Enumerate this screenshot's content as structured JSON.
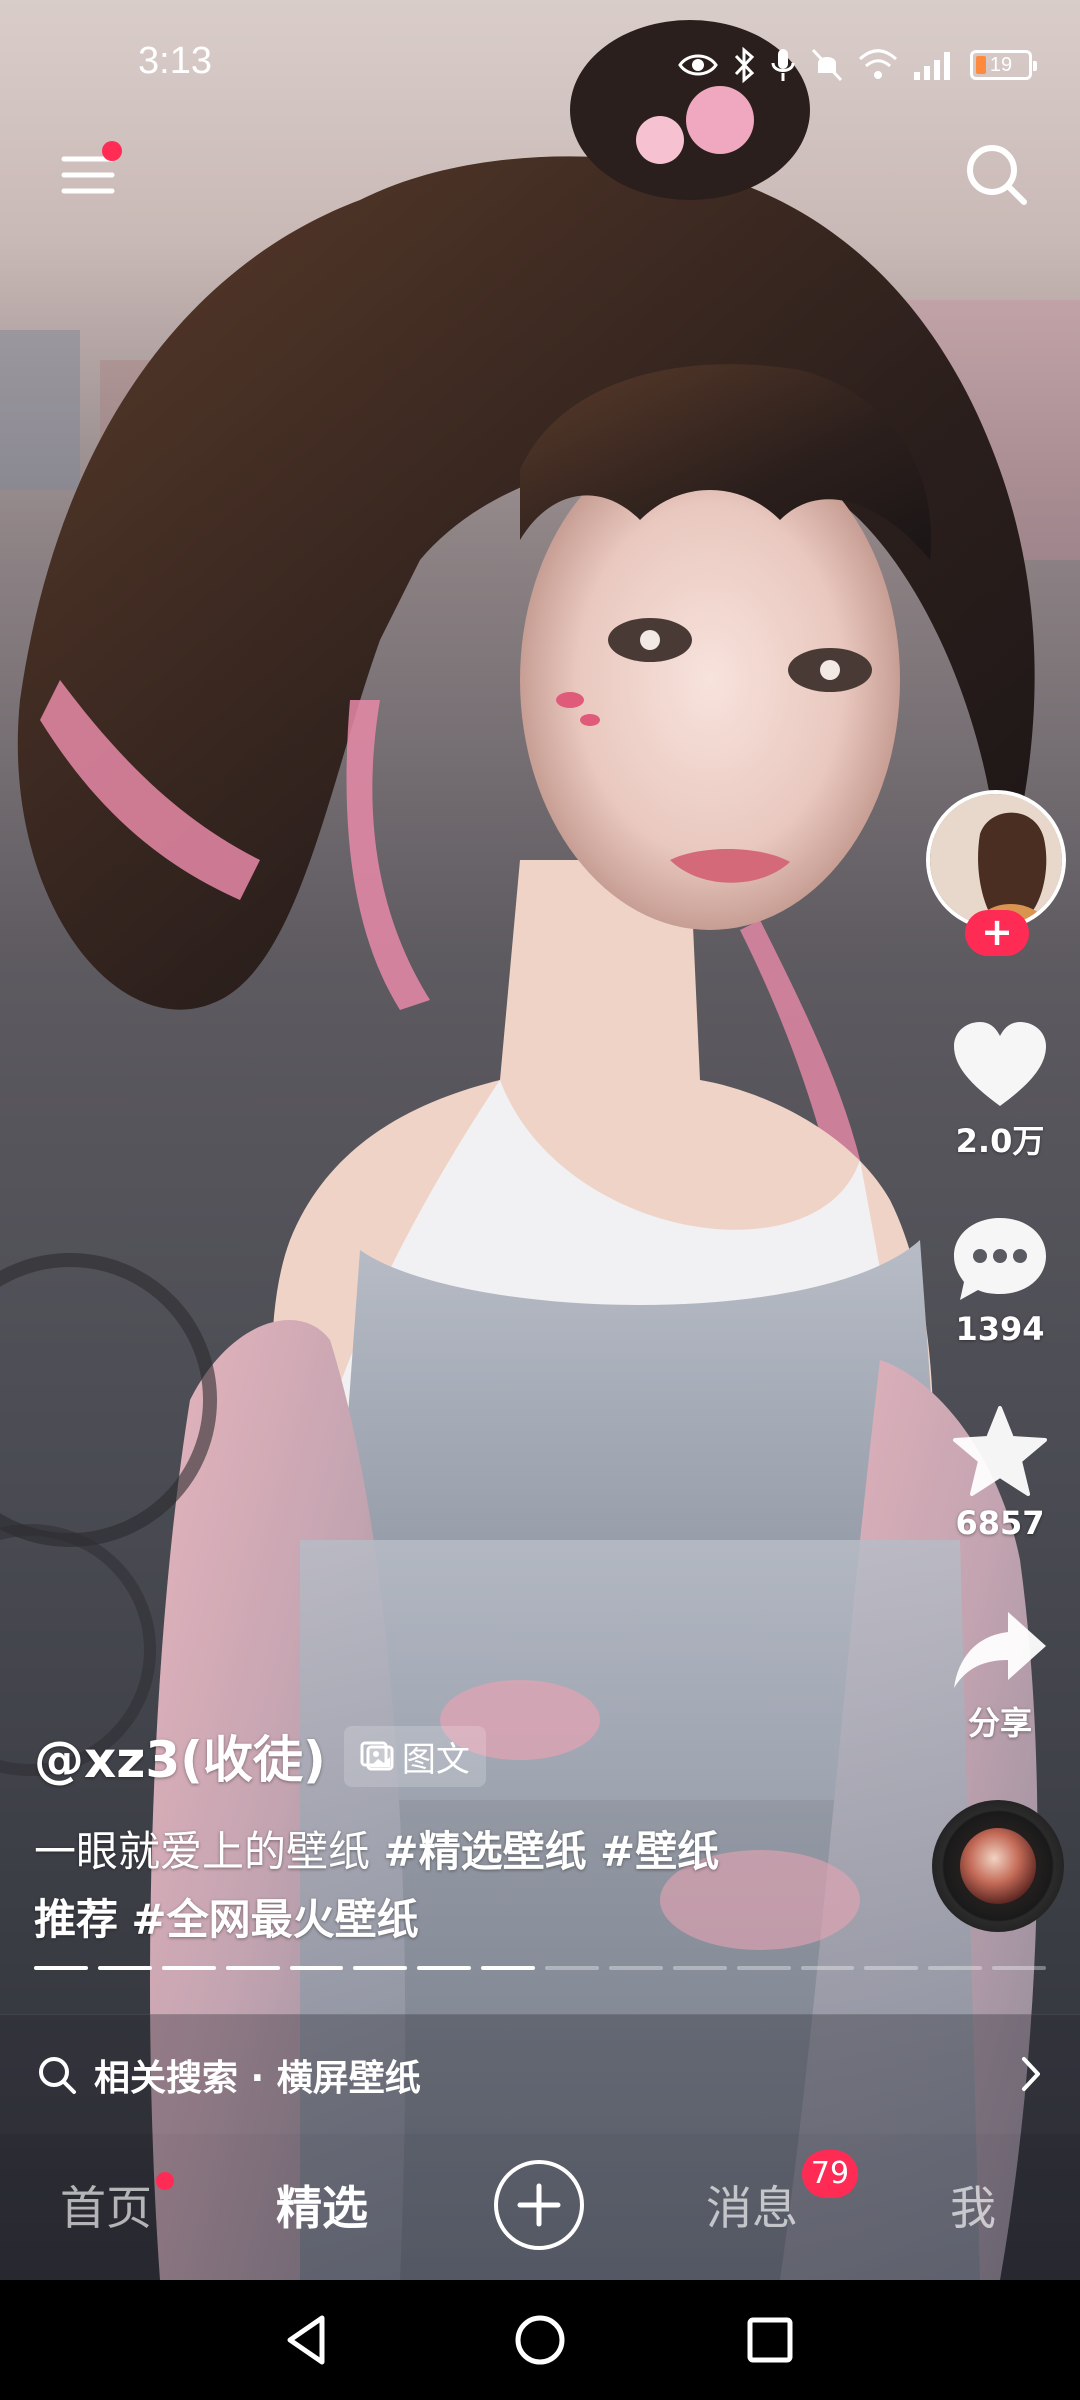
{
  "status_bar": {
    "time": "3:13",
    "battery": "19",
    "icons": [
      "eye-icon",
      "bluetooth-icon",
      "mic-icon",
      "mute-icon",
      "wifi-icon",
      "signal-icon",
      "battery-icon"
    ]
  },
  "top_bar": {
    "menu_icon": "menu-icon",
    "search_icon": "search-icon"
  },
  "rail": {
    "follow_symbol": "+",
    "like_count": "2.0万",
    "comment_count": "1394",
    "favorite_count": "6857",
    "share_label": "分享"
  },
  "caption": {
    "author": "@xz3(收徒)",
    "type_tag": "图文",
    "desc_text": "一眼就爱上的壁纸",
    "hashtag_1": "#精选壁纸",
    "hashtag_2": "#壁纸",
    "hashtag_3": "推荐",
    "hashtag_4": "#全网最火壁纸"
  },
  "progress": {
    "total_segments": 16,
    "current_segment": 8
  },
  "related_search": {
    "text": "相关搜索 · 横屏壁纸"
  },
  "tabs": {
    "home": "首页",
    "featured": "精选",
    "messages": "消息",
    "messages_badge": "79",
    "me": "我"
  },
  "colors": {
    "accent": "#fe2c55",
    "battery_low": "#ff8a3d"
  }
}
